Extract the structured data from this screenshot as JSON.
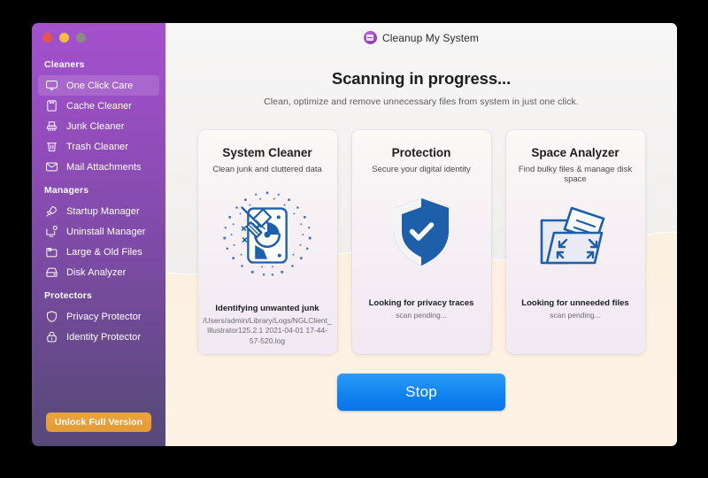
{
  "window": {
    "traffic_lights": [
      "close",
      "minimize",
      "zoom"
    ],
    "colors": {
      "traffic_red": "#e8544a",
      "traffic_yellow": "#f5bd41",
      "traffic_gray": "#8b8b80",
      "sidebar_top": "#a451cd",
      "sidebar_bottom": "#564978",
      "accent_orange": "#eba342",
      "accent_blue": "#1b8cf2",
      "icon_blue": "#1d5fa8",
      "canvas_cream": "#fdf1e2"
    }
  },
  "header": {
    "app_title": "Cleanup My System",
    "logo_icon": "app-logo-icon"
  },
  "main": {
    "headline": "Scanning in progress...",
    "subhead": "Clean, optimize and remove unnecessary files from system in just one click."
  },
  "sidebar": {
    "groups": [
      {
        "title": "Cleaners",
        "items": [
          {
            "label": "One Click Care",
            "icon": "monitor-icon",
            "active": true
          },
          {
            "label": "Cache Cleaner",
            "icon": "cache-box-icon",
            "active": false
          },
          {
            "label": "Junk Cleaner",
            "icon": "broom-icon",
            "active": false
          },
          {
            "label": "Trash Cleaner",
            "icon": "trash-icon",
            "active": false
          },
          {
            "label": "Mail Attachments",
            "icon": "envelope-icon",
            "active": false
          }
        ]
      },
      {
        "title": "Managers",
        "items": [
          {
            "label": "Startup Manager",
            "icon": "rocket-icon",
            "active": false
          },
          {
            "label": "Uninstall Manager",
            "icon": "monitor-gear-icon",
            "active": false
          },
          {
            "label": "Large & Old Files",
            "icon": "folder-clock-icon",
            "active": false
          },
          {
            "label": "Disk Analyzer",
            "icon": "disk-icon",
            "active": false
          }
        ]
      },
      {
        "title": "Protectors",
        "items": [
          {
            "label": "Privacy Protector",
            "icon": "shield-icon",
            "active": false
          },
          {
            "label": "Identity Protector",
            "icon": "lock-icon",
            "active": false
          }
        ]
      }
    ],
    "unlock_button": "Unlock Full Version"
  },
  "cards": [
    {
      "title": "System Cleaner",
      "subtitle": "Clean junk and cluttered data",
      "art_icon": "broom-disk-scan-icon",
      "status": "Identifying unwanted junk",
      "detail": "/Users/admin/Library/Logs/NGLClient_Illustrator125.2.1 2021-04-01 17-44-57-520.log"
    },
    {
      "title": "Protection",
      "subtitle": "Secure your digital identity",
      "art_icon": "shield-check-icon",
      "status": "Looking for privacy traces",
      "detail": "scan pending..."
    },
    {
      "title": "Space Analyzer",
      "subtitle": "Find bulky files & manage disk space",
      "art_icon": "folder-expand-icon",
      "status": "Looking for unneeded files",
      "detail": "scan pending..."
    }
  ],
  "footer": {
    "stop_button": "Stop"
  }
}
